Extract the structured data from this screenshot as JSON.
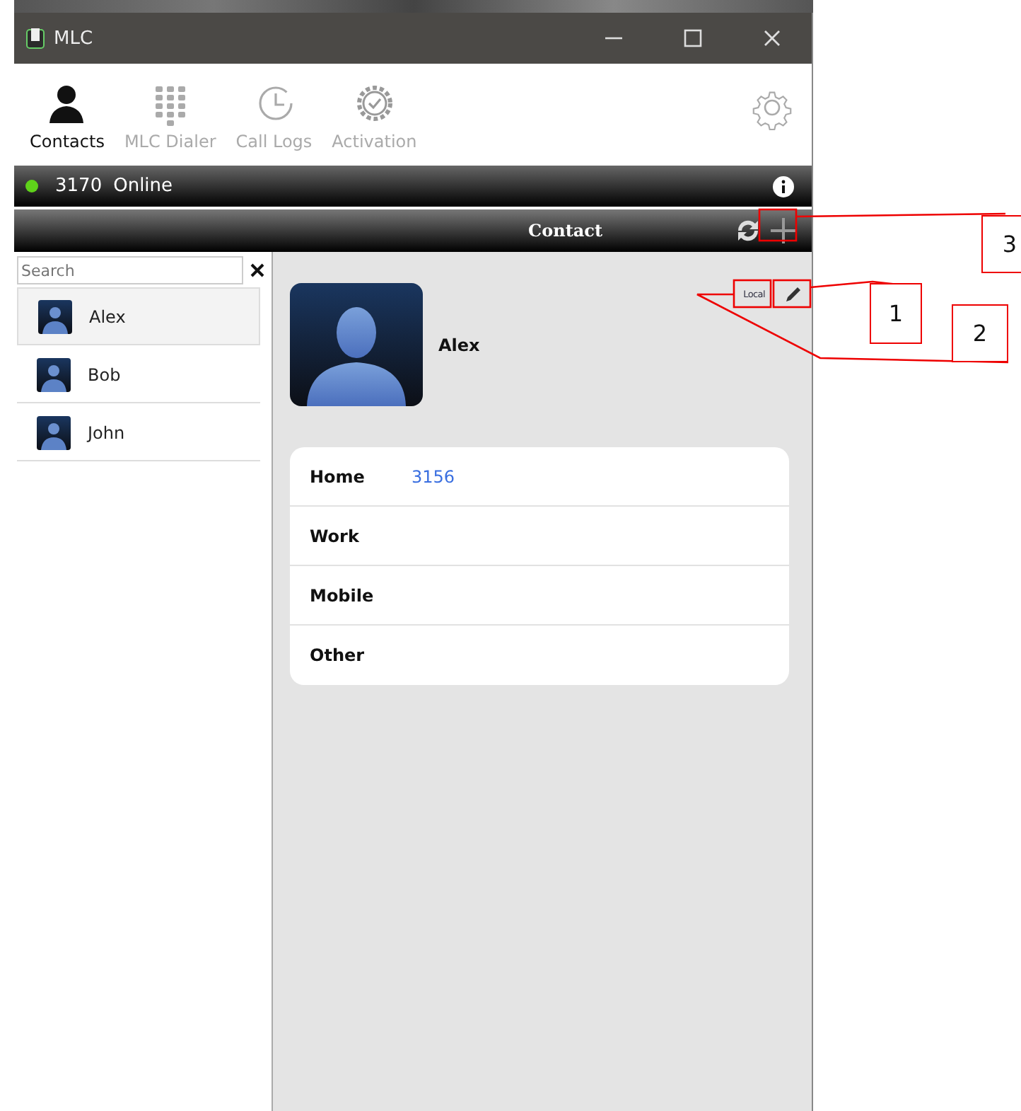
{
  "window": {
    "title": "MLC"
  },
  "nav_tabs": [
    {
      "label": "Contacts",
      "selected": true,
      "kind": "person"
    },
    {
      "label": "MLC Dialer",
      "selected": false,
      "kind": "dialpad"
    },
    {
      "label": "Call Logs",
      "selected": false,
      "kind": "clock"
    },
    {
      "label": "Activation",
      "selected": false,
      "kind": "badge"
    }
  ],
  "status_bar": {
    "number": "3170",
    "status": "Online",
    "online": true
  },
  "header": {
    "title": "Contact"
  },
  "search": {
    "placeholder": "Search"
  },
  "contacts": [
    {
      "name": "Alex",
      "selected": true
    },
    {
      "name": "Bob",
      "selected": false
    },
    {
      "name": "John",
      "selected": false
    }
  ],
  "detail": {
    "name": "Alex",
    "source": "Local",
    "fields": [
      {
        "label": "Home",
        "value": "3156"
      },
      {
        "label": "Work"
      },
      {
        "label": "Mobile"
      },
      {
        "label": "Other"
      }
    ]
  },
  "annotations": [
    {
      "number": "1"
    },
    {
      "number": "2"
    },
    {
      "number": "3"
    }
  ]
}
